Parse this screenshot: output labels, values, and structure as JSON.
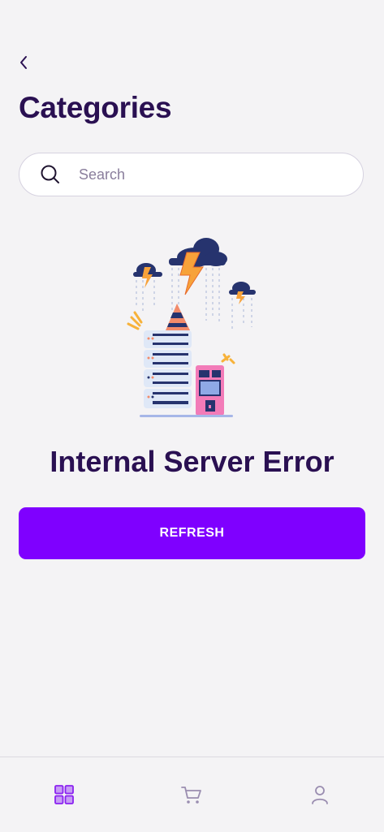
{
  "header": {
    "title": "Categories"
  },
  "search": {
    "placeholder": "Search",
    "value": ""
  },
  "error": {
    "title": "Internal Server Error",
    "button_label": "REFRESH"
  },
  "colors": {
    "primary": "#7f00ff",
    "title": "#2a1052",
    "nav_active": "#9b3df0",
    "nav_inactive": "#9a8db0"
  },
  "bottom_nav": {
    "items": [
      {
        "icon": "grid-icon",
        "active": true
      },
      {
        "icon": "cart-icon",
        "active": false
      },
      {
        "icon": "user-icon",
        "active": false
      }
    ]
  }
}
